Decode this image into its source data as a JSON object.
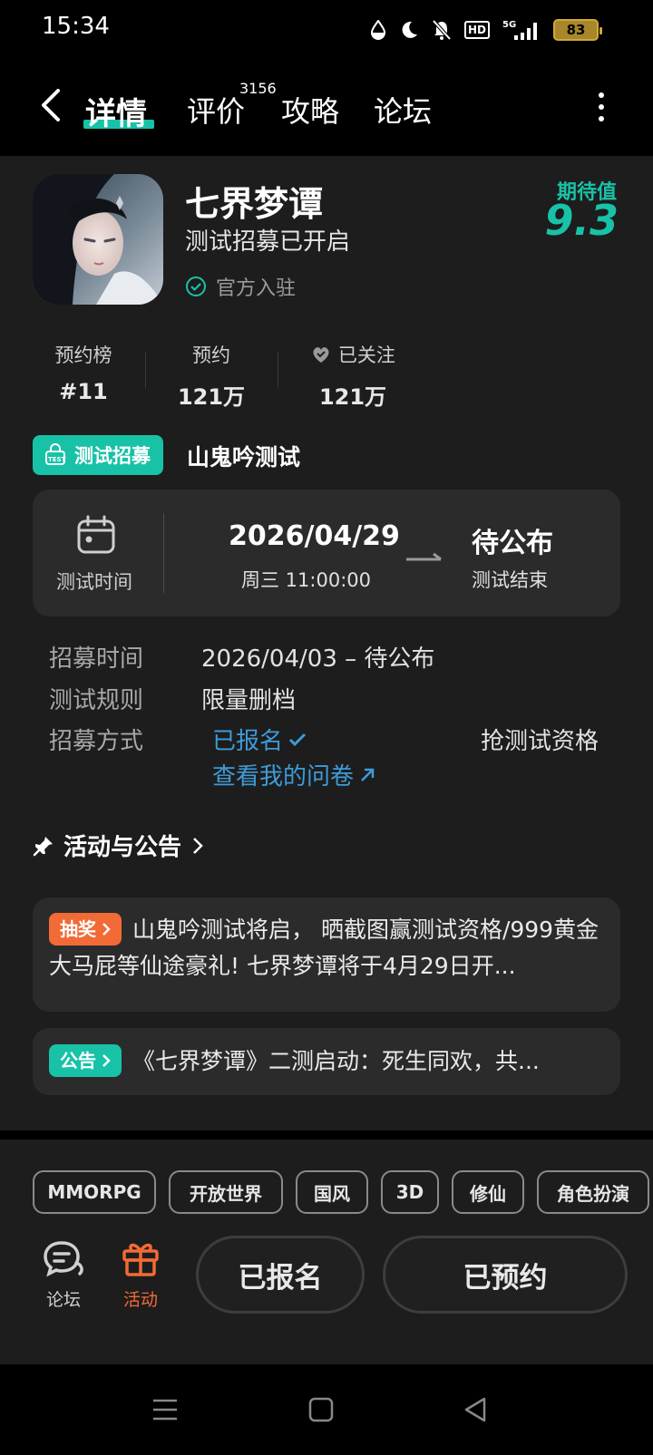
{
  "status_bar": {
    "time": "15:34",
    "battery": "83",
    "network": "5G",
    "hd": "HD"
  },
  "nav": {
    "tabs": [
      {
        "label": "详情",
        "active": true
      },
      {
        "label": "评价",
        "badge": "3156"
      },
      {
        "label": "攻略"
      },
      {
        "label": "论坛"
      }
    ]
  },
  "game": {
    "title": "七界梦谭",
    "subtitle": "测试招募已开启",
    "official": "官方入驻",
    "expect_label": "期待值",
    "expect_score": "9.3"
  },
  "stats": [
    {
      "label": "预约榜",
      "value": "#11"
    },
    {
      "label": "预约",
      "value": "121万"
    },
    {
      "label": "已关注",
      "value": "121万"
    }
  ],
  "recruit": {
    "badge": "测试招募",
    "name": "山鬼吟测试",
    "time_label": "测试时间",
    "start_date": "2026/04/29",
    "start_time": "周三  11:00:00",
    "end_text": "待公布",
    "end_sub": "测试结束",
    "rows": {
      "recruit_time_label": "招募时间",
      "recruit_time": "2026/04/03 – 待公布",
      "rule_label": "测试规则",
      "rule": "限量删档",
      "method_label": "招募方式",
      "signed": "已报名",
      "questionnaire": "查看我的问卷",
      "grab": "抢测试资格"
    }
  },
  "activities": {
    "title": "活动与公告",
    "items": [
      {
        "tag": "抽奖",
        "color": "#f26a35",
        "text": "山鬼吟测试将启， 晒截图赢测试资格/999黄金大马屁等仙途豪礼! 七界梦谭将于4月29日开..."
      },
      {
        "tag": "公告",
        "color": "#18c2a7",
        "text": "《七界梦谭》二测启动：死生同欢，共..."
      }
    ]
  },
  "tags": [
    "MMORPG",
    "开放世界",
    "国风",
    "3D",
    "修仙",
    "角色扮演"
  ],
  "bottom_nav": {
    "forum": "论坛",
    "activity": "活动",
    "signup_button": "已报名",
    "reserve_button": "已预约"
  },
  "colors": {
    "accent": "#18c2a7",
    "orange": "#f26a35",
    "link": "#3e9bd9"
  }
}
